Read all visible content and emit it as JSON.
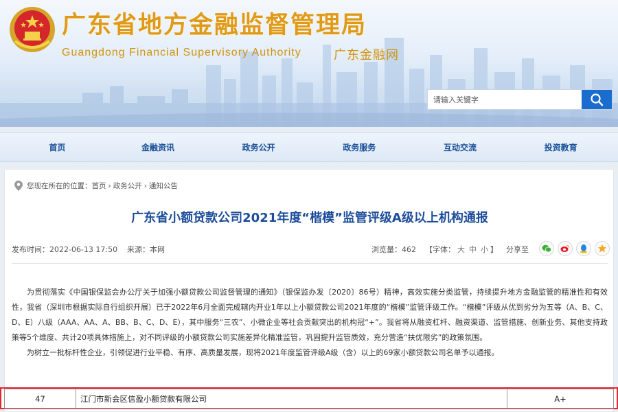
{
  "header": {
    "title": "广东省地方金融监督管理局",
    "subtitle": "Guangdong Financial Supervisory Authority",
    "site_name": "广东金融网",
    "colors": {
      "title": "#e09a1a",
      "accent": "#1a6dcc"
    }
  },
  "search": {
    "placeholder": "请输入关键字",
    "button_icon": "search-icon"
  },
  "nav": {
    "items": [
      {
        "label": "首页"
      },
      {
        "label": "金融资讯"
      },
      {
        "label": "政务公开"
      },
      {
        "label": "政务服务"
      },
      {
        "label": "互动交流"
      },
      {
        "label": "投资教育"
      }
    ]
  },
  "breadcrumb": {
    "prefix": "您现在所在的位置：",
    "items": [
      "首页",
      "政务公开",
      "通知公告"
    ],
    "separator": "›"
  },
  "article": {
    "title": "广东省小额贷款公司2021年度“楷模”监管评级A级以上机构通报",
    "publish_time": "发布时间：2022-06-13 17:50",
    "source": "来源：本网",
    "views": "浏览量：462",
    "font_size": {
      "prefix": "【字体：",
      "options": [
        "大",
        "中",
        "小"
      ],
      "suffix": "】"
    },
    "share_label": "分享至",
    "share_icons": [
      "wechat-icon",
      "weibo-icon",
      "qq-icon",
      "favorite-icon"
    ],
    "paragraphs": [
      "为贯彻落实《中国银保监会办公厅关于加强小额贷款公司监督管理的通知》（银保监办发〔2020〕86号）精神，高效实施分类监管，持续提升地方金融监管的精准性和有效性，我省（深圳市根据实际自行组织开展）已于2022年6月全面完成辖内开业1年以上小额贷款公司2021年度的“楷模”监管评级工作。“楷模”评级从优到劣分为五等（A、B、C、D、E）八级（AAA、AA、A、BB、B、C、D、E），其中服务“三农”、小微企业等社会贡献突出的机构冠“+”。我省将从融资杠杆、融资渠道、监管措施、创新业务、其他支持政策等5个维度、共计20项具体措施上，对不同评级的小额贷款公司实施差异化精准监管，巩固提升监管质效，充分营造“扶优限劣”的政策氛围。",
      "为树立一批标杆性企业，引领促进行业平稳、有序、高质量发展，现将2021年度监管评级A级（含）以上的69家小额贷款公司名单予以通报。"
    ]
  },
  "table": {
    "rows": [
      {
        "no": "47",
        "name": "江门市新会区信盈小额贷款有限公司",
        "grade": "A+"
      }
    ],
    "highlight_color": "#e0282e"
  }
}
